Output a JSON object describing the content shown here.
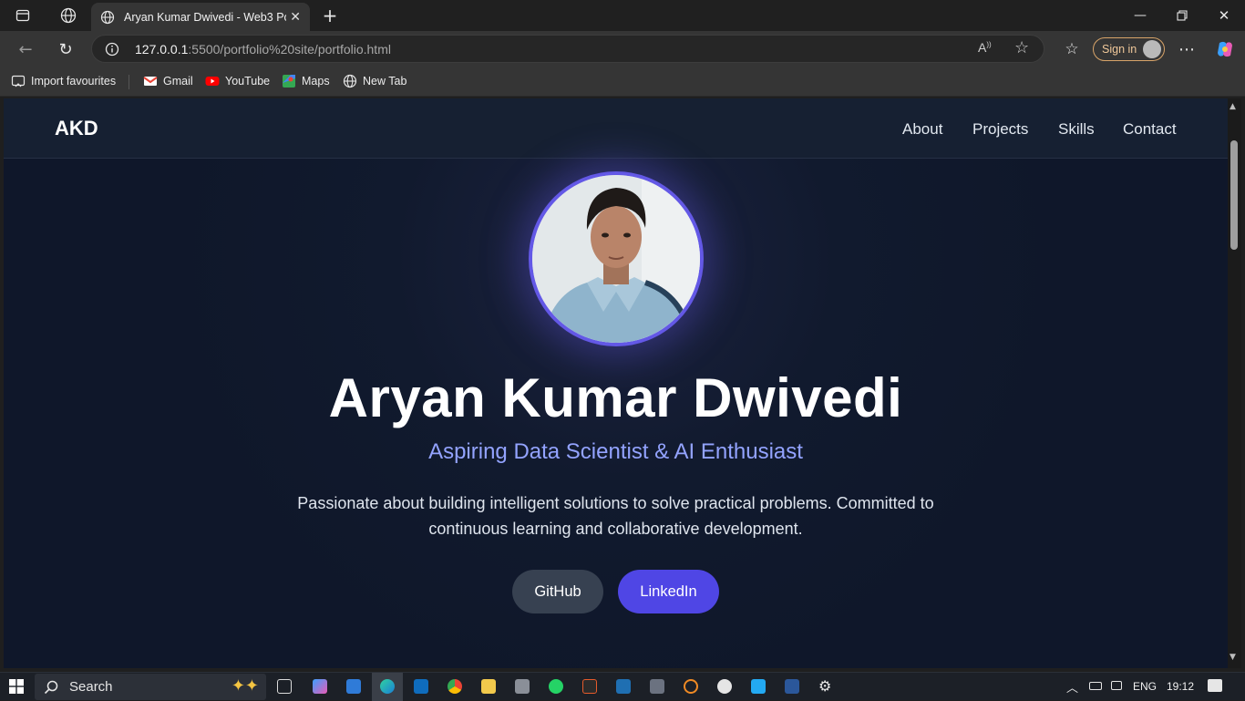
{
  "browser": {
    "tab_title": "Aryan Kumar Dwivedi - Web3 Por",
    "url_host": "127.0.0.1",
    "url_path": ":5500/portfolio%20site/portfolio.html",
    "sign_in_label": "Sign in",
    "bookmarks": [
      {
        "label": "Import favourites",
        "icon": "import-icon"
      },
      {
        "label": "Gmail",
        "icon": "gmail-icon"
      },
      {
        "label": "YouTube",
        "icon": "youtube-icon"
      },
      {
        "label": "Maps",
        "icon": "maps-icon"
      },
      {
        "label": "New Tab",
        "icon": "globe-icon"
      }
    ]
  },
  "site": {
    "logo": "AKD",
    "nav": [
      "About",
      "Projects",
      "Skills",
      "Contact"
    ],
    "hero": {
      "name": "Aryan Kumar Dwivedi",
      "subtitle": "Aspiring Data Scientist & AI Enthusiast",
      "description": "Passionate about building intelligent solutions to solve practical problems. Committed to continuous learning and collaborative development.",
      "buttons": [
        "GitHub",
        "LinkedIn"
      ]
    },
    "colors": {
      "background": "#0f172a",
      "accent": "#4f46e5",
      "subtitle": "#93a3ff"
    }
  },
  "taskbar": {
    "search_placeholder": "Search",
    "language": "ENG",
    "time": "19:12"
  }
}
